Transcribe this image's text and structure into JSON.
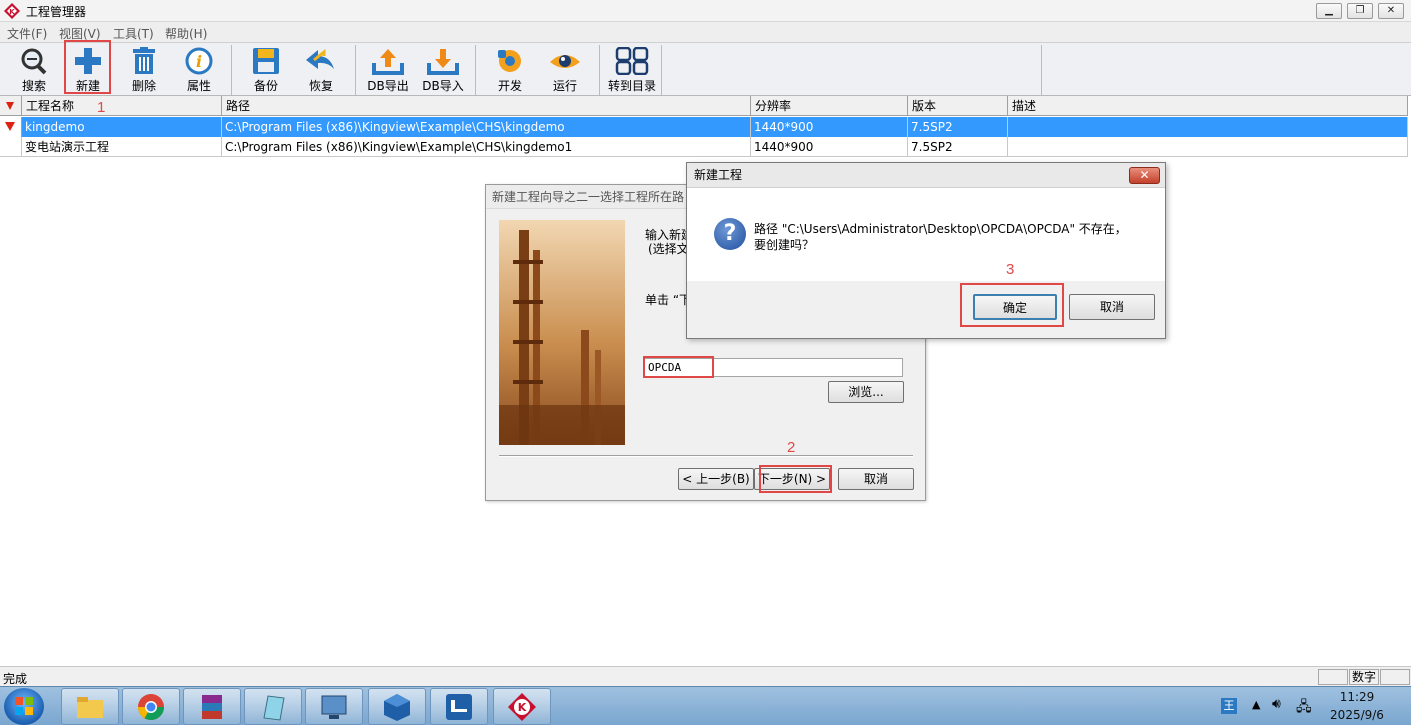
{
  "window": {
    "title": "工程管理器"
  },
  "menu": [
    "文件(F)",
    "视图(V)",
    "工具(T)",
    "帮助(H)"
  ],
  "toolbar": {
    "search": "搜索",
    "new": "新建",
    "delete": "删除",
    "properties": "属性",
    "backup": "备份",
    "restore": "恢复",
    "db_export": "DB导出",
    "db_import": "DB导入",
    "develop": "开发",
    "run": "运行",
    "goto_dir": "转到目录"
  },
  "table": {
    "headers": [
      "工程名称",
      "路径",
      "分辨率",
      "版本",
      "描述"
    ],
    "rows": [
      {
        "name": "kingdemo",
        "path": "C:\\Program Files (x86)\\Kingview\\Example\\CHS\\kingdemo",
        "resolution": "1440*900",
        "version": "7.5SP2",
        "desc": "",
        "selected": true
      },
      {
        "name": "变电站演示工程",
        "path": "C:\\Program Files (x86)\\Kingview\\Example\\CHS\\kingdemo1",
        "resolution": "1440*900",
        "version": "7.5SP2",
        "desc": "",
        "selected": false
      }
    ]
  },
  "wizard": {
    "title": "新建工程向导之二一选择工程所在路",
    "text1": "输入新建",
    "text2": "(选择文",
    "text3": "单击 “下",
    "input_value": "OPCDA",
    "browse": "浏览...",
    "back": "< 上一步(B)",
    "next": "下一步(N) >",
    "cancel": "取消"
  },
  "dialog": {
    "title": "新建工程",
    "close": "✕",
    "line1": "路径 \"C:\\Users\\Administrator\\Desktop\\OPCDA\\OPCDA\" 不存在，",
    "line2": "要创建吗？",
    "ok": "确定",
    "cancel": "取消"
  },
  "annotations": {
    "n1": "1",
    "n2": "2",
    "n3": "3"
  },
  "status": {
    "text": "完成",
    "numlock": "数字"
  },
  "tray": {
    "time": "11:29",
    "date": "2025/9/6",
    "ime": "王"
  },
  "colors": {
    "selection": "#3399ff",
    "annotation": "#e04848",
    "toolbar_blue": "#2b79c2"
  }
}
